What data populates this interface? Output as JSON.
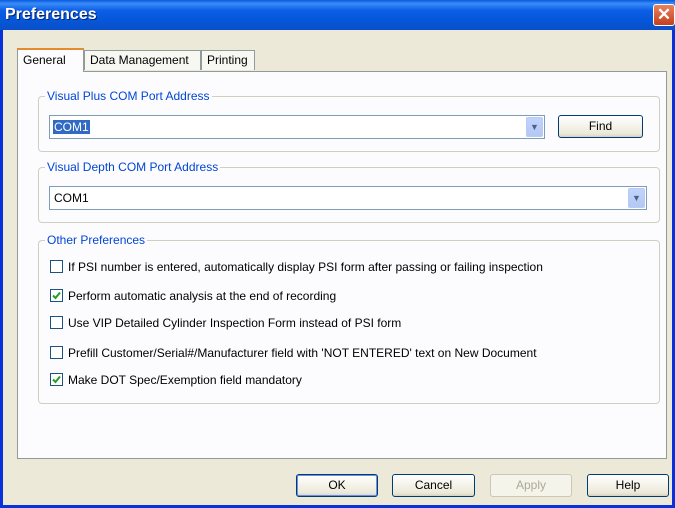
{
  "window": {
    "title": "Preferences",
    "close_glyph": "✕"
  },
  "tabs": [
    {
      "label": "General",
      "active": true
    },
    {
      "label": "Data Management",
      "active": false
    },
    {
      "label": "Printing",
      "active": false
    }
  ],
  "visual_plus": {
    "title": "Visual Plus COM Port Address",
    "value": "COM1",
    "find_label": "Find"
  },
  "visual_depth": {
    "title": "Visual Depth COM Port Address",
    "value": "COM1"
  },
  "other": {
    "title": "Other Preferences",
    "options": [
      {
        "label": "If PSI number is entered, automatically display PSI form after passing or failing inspection",
        "checked": false
      },
      {
        "label": "Perform automatic analysis at the end of recording",
        "checked": true
      },
      {
        "label": "Use VIP Detailed Cylinder Inspection Form instead of PSI form",
        "checked": false
      },
      {
        "label": "Prefill Customer/Serial#/Manufacturer field with 'NOT ENTERED' text on New Document",
        "checked": false
      },
      {
        "label": "Make DOT Spec/Exemption field mandatory",
        "checked": true
      }
    ]
  },
  "buttons": {
    "ok": "OK",
    "cancel": "Cancel",
    "apply": "Apply",
    "help": "Help"
  },
  "icons": {
    "dropdown": "chevron-down-icon",
    "check": "check-icon",
    "close": "close-icon"
  },
  "colors": {
    "title_bar": "#0a5be0",
    "group_title": "#0046d5",
    "check_mark": "#21a121",
    "active_tab_border": "#e68b2c"
  }
}
